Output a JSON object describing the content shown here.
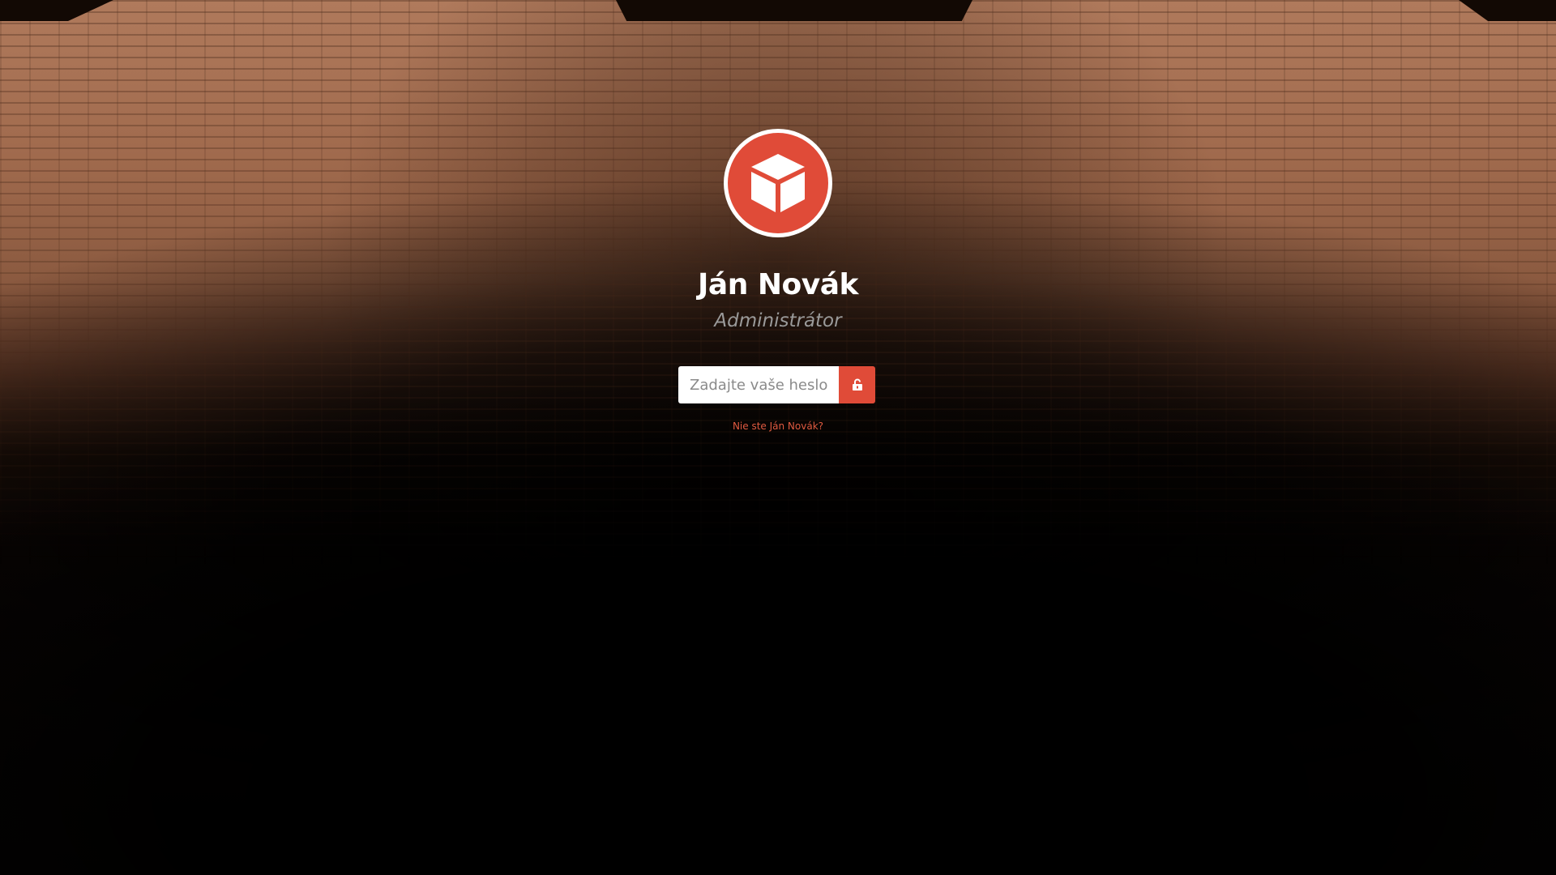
{
  "user": {
    "name": "Ján Novák",
    "role": "Administrátor",
    "avatar_icon": "cube-icon"
  },
  "password": {
    "placeholder": "Zadajte vaše heslo..",
    "value": ""
  },
  "unlock": {
    "icon": "unlock-icon"
  },
  "links": {
    "not_you": "Nie ste Ján Novák?"
  },
  "colors": {
    "accent": "#e04b38",
    "link": "#e05a40",
    "name_text": "#ffffff",
    "role_text": "#9a9a9a"
  }
}
